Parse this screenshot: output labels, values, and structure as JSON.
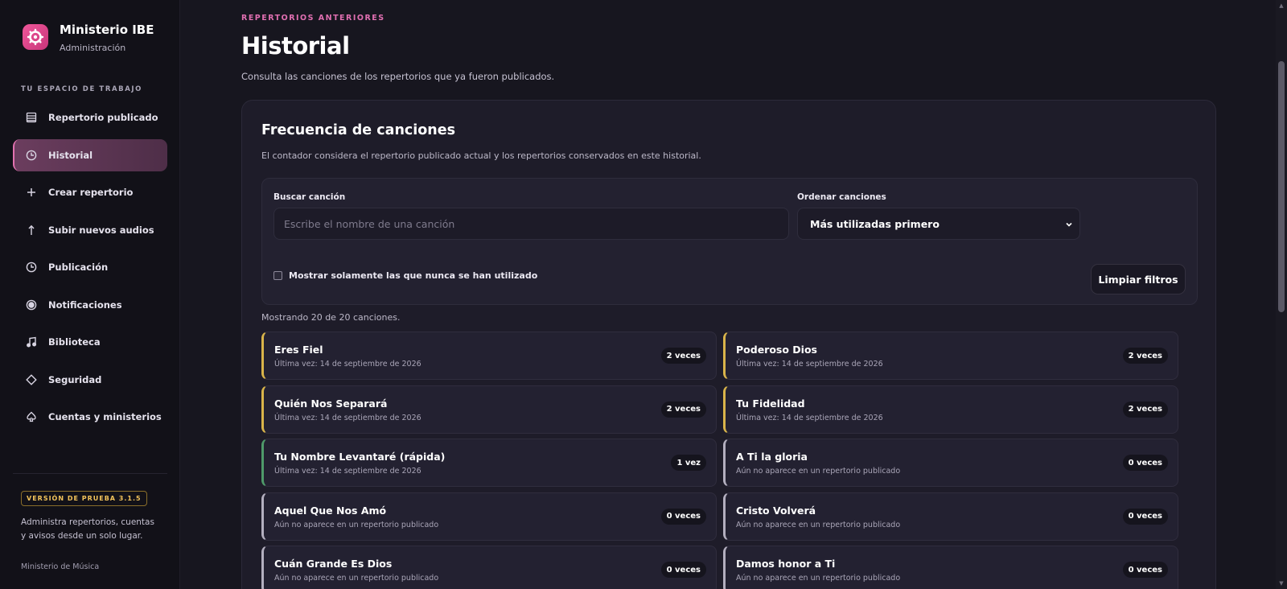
{
  "brand": {
    "title": "Ministerio IBE",
    "subtitle": "Administración"
  },
  "sidebar": {
    "section_label": "TU ESPACIO DE TRABAJO",
    "items": [
      {
        "label": "Repertorio publicado",
        "icon": "list-icon"
      },
      {
        "label": "Historial",
        "icon": "clock-icon",
        "active": true
      },
      {
        "label": "Crear repertorio",
        "icon": "plus-icon"
      },
      {
        "label": "Subir nuevos audios",
        "icon": "arrow-up-icon"
      },
      {
        "label": "Publicación",
        "icon": "clock-icon"
      },
      {
        "label": "Notificaciones",
        "icon": "radio-icon"
      },
      {
        "label": "Biblioteca",
        "icon": "music-note-icon"
      },
      {
        "label": "Seguridad",
        "icon": "diamond-icon"
      },
      {
        "label": "Cuentas y ministerios",
        "icon": "spade-icon"
      }
    ],
    "version": "VERSIÓN DE PRUEBA 3.1.5",
    "description": "Administra repertorios, cuentas y avisos desde un solo lugar.",
    "footer": "Ministerio de Música"
  },
  "header": {
    "eyebrow": "REPERTORIOS ANTERIORES",
    "title": "Historial",
    "description": "Consulta las canciones de los repertorios que ya fueron publicados."
  },
  "frequency": {
    "title": "Frecuencia de canciones",
    "description": "El contador considera el repertorio publicado actual y los repertorios conservados en este historial.",
    "search_label": "Buscar canción",
    "search_placeholder": "Escribe el nombre de una canción",
    "search_value": "",
    "sort_label": "Ordenar canciones",
    "sort_value": "Más utilizadas primero",
    "checkbox_label": "Mostrar solamente las que nunca se han utilizado",
    "checkbox_checked": false,
    "clear_label": "Limpiar filtros",
    "showing": "Mostrando 20 de 20 canciones."
  },
  "colors": {
    "accent": "#e06fb1",
    "gold": "#d9b44a",
    "green": "#4f9a6a",
    "gray": "#b3afbf"
  },
  "songs": [
    {
      "name": "Eres Fiel",
      "meta": "Última vez: 14 de septiembre de 2026",
      "count": "2 veces",
      "tier": "gold"
    },
    {
      "name": "Poderoso Dios",
      "meta": "Última vez: 14 de septiembre de 2026",
      "count": "2 veces",
      "tier": "gold"
    },
    {
      "name": "Quién Nos Separará",
      "meta": "Última vez: 14 de septiembre de 2026",
      "count": "2 veces",
      "tier": "gold"
    },
    {
      "name": "Tu Fidelidad",
      "meta": "Última vez: 14 de septiembre de 2026",
      "count": "2 veces",
      "tier": "gold"
    },
    {
      "name": "Tu Nombre Levantaré (rápida)",
      "meta": "Última vez: 14 de septiembre de 2026",
      "count": "1 vez",
      "tier": "green"
    },
    {
      "name": "A Ti la gloria",
      "meta": "Aún no aparece en un repertorio publicado",
      "count": "0 veces",
      "tier": "gray"
    },
    {
      "name": "Aquel Que Nos Amó",
      "meta": "Aún no aparece en un repertorio publicado",
      "count": "0 veces",
      "tier": "gray"
    },
    {
      "name": "Cristo Volverá",
      "meta": "Aún no aparece en un repertorio publicado",
      "count": "0 veces",
      "tier": "gray"
    },
    {
      "name": "Cuán Grande Es Dios",
      "meta": "Aún no aparece en un repertorio publicado",
      "count": "0 veces",
      "tier": "gray"
    },
    {
      "name": "Damos honor a Ti",
      "meta": "Aún no aparece en un repertorio publicado",
      "count": "0 veces",
      "tier": "gray"
    }
  ]
}
